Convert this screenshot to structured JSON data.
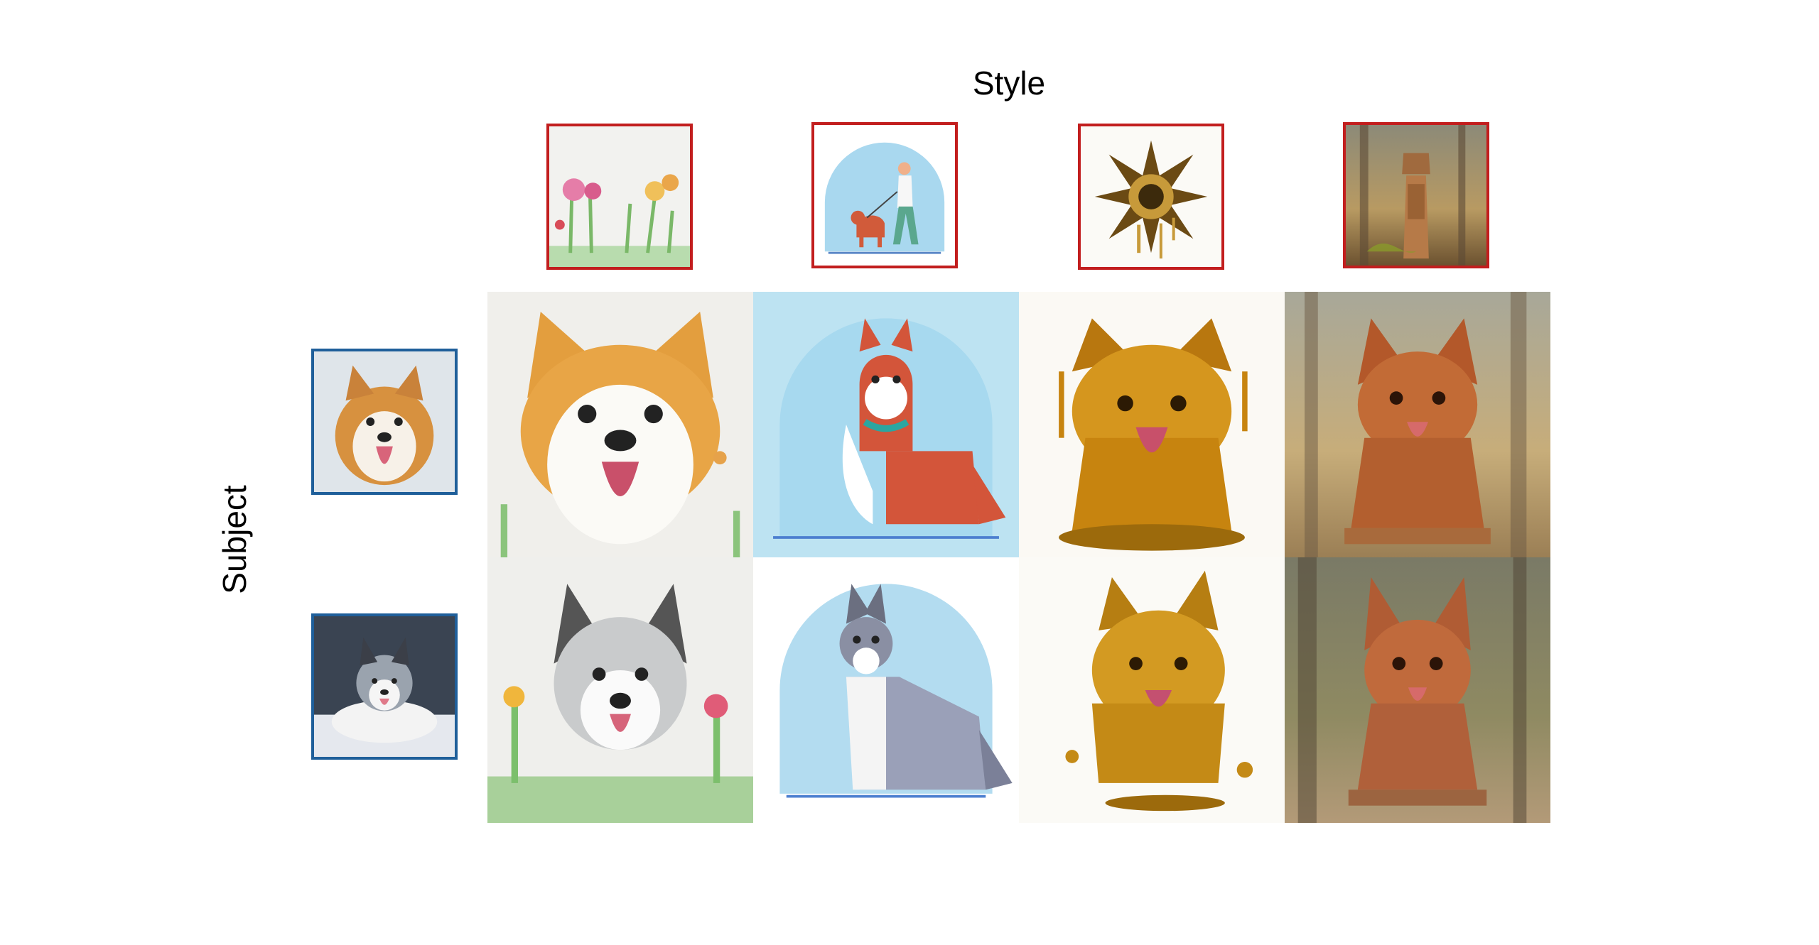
{
  "figure": {
    "column_label": "Style",
    "row_label": "Subject"
  },
  "styles": [
    {
      "id": "watercolor",
      "icon": "watercolor-flowers-icon"
    },
    {
      "id": "flat-illustration",
      "icon": "woman-walking-dog-icon"
    },
    {
      "id": "melting-gold",
      "icon": "gold-flower-icon"
    },
    {
      "id": "wood-carving",
      "icon": "wooden-statue-icon"
    }
  ],
  "subjects": [
    {
      "id": "corgi",
      "icon": "corgi-photo-icon"
    },
    {
      "id": "merle-collie",
      "icon": "collie-photo-icon"
    }
  ],
  "colors": {
    "style_border": "#c21e1e",
    "subject_border": "#1f5f9a"
  }
}
